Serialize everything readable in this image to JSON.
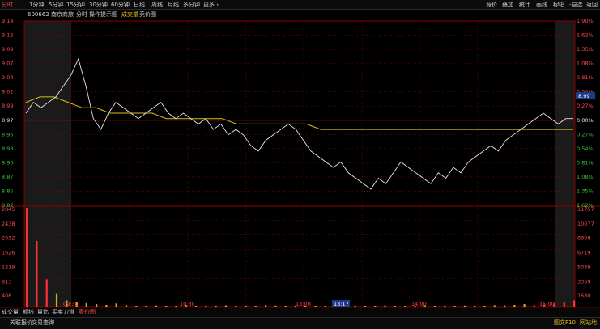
{
  "topbar": {
    "left_tabs": [
      {
        "label": "分时",
        "active": true
      },
      {
        "label": "1分钟"
      },
      {
        "label": "5分钟"
      },
      {
        "label": "15分钟"
      },
      {
        "label": "30分钟"
      },
      {
        "label": "60分钟"
      },
      {
        "label": "日线"
      },
      {
        "label": "周线"
      },
      {
        "label": "月线"
      },
      {
        "label": "多分钟"
      },
      {
        "label": "更多 ›"
      }
    ],
    "right_tabs": [
      {
        "label": "竞价"
      },
      {
        "label": "叠加"
      },
      {
        "label": "统计"
      },
      {
        "label": "画线"
      },
      {
        "label": "标记"
      },
      {
        "label": "-自选"
      },
      {
        "label": "返回"
      }
    ]
  },
  "subheader": {
    "code": "600662 南京商旅",
    "items": [
      {
        "label": "分时",
        "color": "#cfcfcf"
      },
      {
        "label": "操作提示图",
        "color": "#cfcfcf"
      },
      {
        "label": "成交量",
        "color": "#e0c020"
      },
      {
        "label": "竞价图",
        "color": "#cfcfcf"
      }
    ]
  },
  "price_axis": {
    "left_labels": [
      "9.14",
      "9.12",
      "9.09",
      "9.07",
      "9.04",
      "9.02",
      "8.99",
      "8.97",
      "8.95",
      "8.93",
      "8.90",
      "8.87",
      "8.85",
      "8.82"
    ],
    "right_labels": [
      "1.90%",
      "1.62%",
      "1.35%",
      "1.08%",
      "0.81%",
      "0.54%",
      "0.27%",
      "0.00%",
      "0.27%",
      "0.54%",
      "0.81%",
      "1.08%",
      "1.35%",
      "1.62%"
    ],
    "current_price_tag": "8.99"
  },
  "volume_axis": {
    "left_labels": [
      "2845",
      "2438",
      "2032",
      "1626",
      "1219",
      "813",
      "406"
    ],
    "right_labels": [
      "11757",
      "10077",
      "8398",
      "6719",
      "5039",
      "3359",
      "1680"
    ]
  },
  "time_axis": {
    "labels": [
      "09:30",
      "10:30",
      "13:00",
      "14:00",
      "15:00"
    ],
    "cursor_label": "13:17"
  },
  "bottombar": {
    "items": [
      {
        "label": "成交量",
        "color": "#cfcfcf"
      },
      {
        "label": "额线",
        "color": "#cfcfcf"
      },
      {
        "label": "量比",
        "color": "#cfcfcf"
      },
      {
        "label": "买卖力道",
        "color": "#cfcfcf"
      },
      {
        "label": "竞价图",
        "color": "#ff4a4a"
      }
    ]
  },
  "statusbar": {
    "left": [
      {
        "label": "关联报价"
      },
      {
        "label": "交易查询"
      }
    ],
    "right": [
      {
        "label": "图文F10"
      },
      {
        "label": "网站地"
      }
    ]
  },
  "colors": {
    "grid": "#8a0000",
    "price_line": "#e6e6e6",
    "avg_line": "#d8c020",
    "vol_up": "#ff3030",
    "vol_bar": "#c8b020",
    "cursor_label_bg": "#1c3b8a"
  },
  "chart_data": {
    "type": "line",
    "title": "",
    "xlabel": "",
    "ylabel": "",
    "ylim": [
      8.8,
      9.14
    ],
    "x": [
      "09:30",
      "10:30",
      "13:00",
      "14:00",
      "15:00"
    ],
    "series": [
      {
        "values": [
          8.97,
          8.99,
          8.98,
          8.99,
          9.0,
          9.02,
          9.04,
          9.07,
          9.02,
          8.96,
          8.94,
          8.97,
          8.99,
          8.98,
          8.97,
          8.96,
          8.97,
          8.98,
          8.99,
          8.97,
          8.96,
          8.97,
          8.96,
          8.95,
          8.96,
          8.94,
          8.95,
          8.93,
          8.94,
          8.93,
          8.91,
          8.9,
          8.92,
          8.93,
          8.94,
          8.95,
          8.94,
          8.92,
          8.9,
          8.89,
          8.88,
          8.87,
          8.88,
          8.86,
          8.85,
          8.84,
          8.83,
          8.85,
          8.84,
          8.86,
          8.88,
          8.87,
          8.86,
          8.85,
          8.84,
          8.86,
          8.85,
          8.87,
          8.86,
          8.88,
          8.89,
          8.9,
          8.91,
          8.9,
          8.92,
          8.93,
          8.94,
          8.95,
          8.96,
          8.97,
          8.96,
          8.95,
          8.96,
          8.96
        ]
      },
      {
        "values": [
          8.99,
          9.0,
          9.0,
          8.99,
          8.98,
          8.98,
          8.97,
          8.97,
          8.97,
          8.97,
          8.96,
          8.96,
          8.96,
          8.96,
          8.96,
          8.95,
          8.95,
          8.95,
          8.95,
          8.95,
          8.95,
          8.94,
          8.94,
          8.94,
          8.94,
          8.94,
          8.94,
          8.94,
          8.94,
          8.94,
          8.94,
          8.94,
          8.94,
          8.94,
          8.94,
          8.94,
          8.94,
          8.94,
          8.94,
          8.94
        ]
      }
    ],
    "volume": [
      2845,
      1900,
      800,
      380,
      200,
      160,
      120,
      90,
      70,
      110,
      60,
      40,
      35,
      50,
      45,
      30,
      60,
      40,
      45,
      30,
      55,
      35,
      40,
      30,
      60,
      50,
      45,
      35,
      40,
      30,
      45,
      55,
      35,
      40,
      30,
      25,
      50,
      40,
      45,
      35,
      60,
      30,
      40,
      35,
      50,
      45,
      40,
      60,
      55,
      70,
      90,
      60,
      80,
      110,
      150,
      200
    ]
  }
}
